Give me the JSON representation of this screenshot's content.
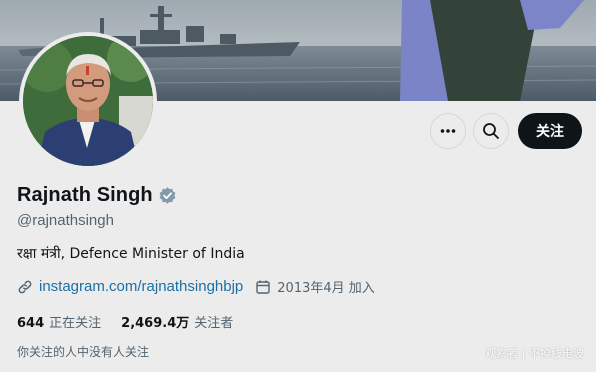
{
  "profile": {
    "name": "Rajnath Singh",
    "handle": "@rajnathsingh",
    "bio": "रक्षा मंत्री, Defence Minister of India",
    "link": "instagram.com/rajnathsinghbjp",
    "joined": "2013年4月 加入",
    "following_count": "644",
    "following_label": "正在关注",
    "followers_count": "2,469.4万",
    "followers_label": "关注者",
    "mutuals_text": "你关注的人中没有人关注"
  },
  "actions": {
    "follow_label": "关注"
  },
  "watermark": "观察者 | 不掉线电波",
  "colors": {
    "text_primary": "#0f1419",
    "text_secondary": "#536471",
    "link": "#1d6fa5",
    "follow_bg": "#0f1419",
    "verified_badge": "#829aab",
    "background": "#ececec"
  },
  "icons": {
    "more": "more-dots-icon",
    "search": "search-icon",
    "verified": "verified-badge-icon",
    "link": "link-icon",
    "calendar": "calendar-icon"
  }
}
